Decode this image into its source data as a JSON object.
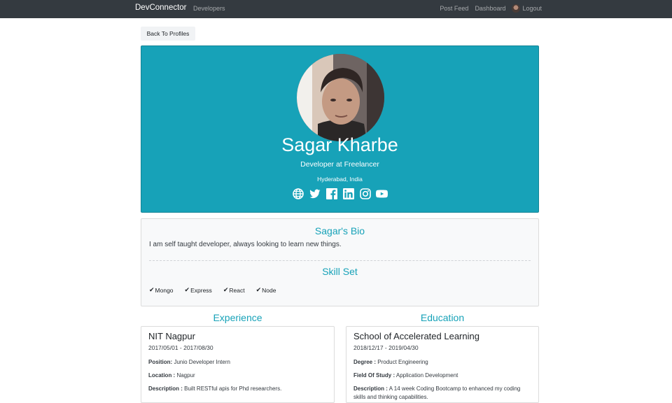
{
  "navbar": {
    "brand": "DevConnector",
    "left_link": "Developers",
    "right_links": [
      "Post Feed",
      "Dashboard"
    ],
    "logout_label": "Logout"
  },
  "back_button": "Back To Profiles",
  "profile": {
    "name": "Sagar Kharbe",
    "role": "Developer at Freelancer",
    "location": "Hyderabad, India",
    "social_icons": [
      "globe-icon",
      "twitter-icon",
      "facebook-icon",
      "linkedin-icon",
      "instagram-icon",
      "youtube-icon"
    ],
    "accent_color": "#17a2b8"
  },
  "bio": {
    "title": "Sagar's Bio",
    "text": "I am self taught developer, always looking to learn new things.",
    "skills_title": "Skill Set",
    "skills": [
      "Mongo",
      "Express",
      "React",
      "Node"
    ]
  },
  "experience": {
    "title": "Experience",
    "company": "NIT Nagpur",
    "dates": "2017/05/01 - 2017/08/30",
    "position_label": "Position:",
    "position": "Junio Developer Intern",
    "location_label": "Location :",
    "location": "Nagpur",
    "description_label": "Description :",
    "description": "Built RESTful apis for Phd researchers."
  },
  "education": {
    "title": "Education",
    "school": "School of Accelerated Learning",
    "dates": "2018/12/17 - 2019/04/30",
    "degree_label": "Degree :",
    "degree": "Product Engineering",
    "field_label": "Field Of Study :",
    "field": "Application Development",
    "description_label": "Description :",
    "description": "A 14 week Coding Bootcamp to enhanced my coding skills and thinking capabilities."
  }
}
